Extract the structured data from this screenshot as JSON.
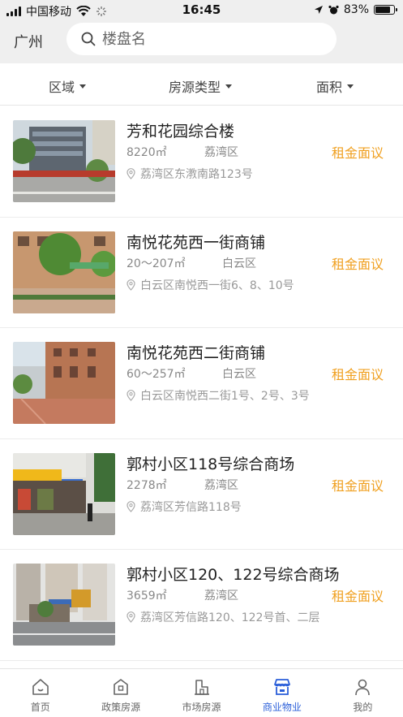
{
  "status_bar": {
    "carrier": "中国移动",
    "time": "16:45",
    "battery_percent": "83%",
    "battery_level": 0.83
  },
  "header": {
    "city": "广州",
    "search_placeholder": "楼盘名"
  },
  "filters": [
    {
      "label": "区域"
    },
    {
      "label": "房源类型"
    },
    {
      "label": "面积"
    }
  ],
  "listings": [
    {
      "name": "芳和花园综合楼",
      "area": "8220㎡",
      "district": "荔湾区",
      "price": "租金面议",
      "address": "荔湾区东漖南路123号"
    },
    {
      "name": "南悦花苑西一街商铺",
      "area": "20～207㎡",
      "district": "白云区",
      "price": "租金面议",
      "address": "白云区南悦西一街6、8、10号"
    },
    {
      "name": "南悦花苑西二街商铺",
      "area": "60～257㎡",
      "district": "白云区",
      "price": "租金面议",
      "address": "白云区南悦西二街1号、2号、3号"
    },
    {
      "name": "郭村小区118号综合商场",
      "area": "2278㎡",
      "district": "荔湾区",
      "price": "租金面议",
      "address": "荔湾区芳信路118号"
    },
    {
      "name": "郭村小区120、122号综合商场",
      "area": "3659㎡",
      "district": "荔湾区",
      "price": "租金面议",
      "address": "荔湾区芳信路120、122号首、二层"
    }
  ],
  "tabs": [
    {
      "label": "首页",
      "icon": "home-icon"
    },
    {
      "label": "政策房源",
      "icon": "policy-house-icon"
    },
    {
      "label": "市场房源",
      "icon": "market-house-icon"
    },
    {
      "label": "商业物业",
      "icon": "store-icon",
      "active": true
    },
    {
      "label": "我的",
      "icon": "user-icon"
    }
  ],
  "colors": {
    "accent": "#2b5fd9",
    "price": "#f0a020",
    "header_bg": "#efefef"
  }
}
